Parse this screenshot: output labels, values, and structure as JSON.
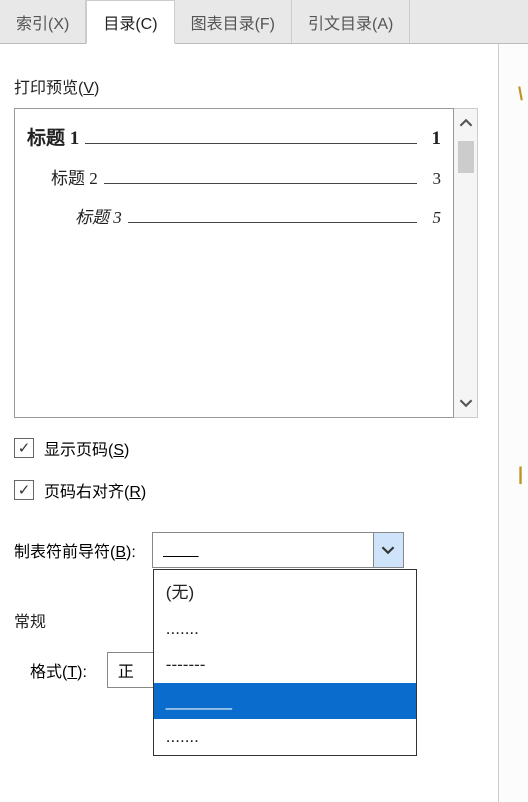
{
  "tabs": {
    "index": "索引(X)",
    "toc": "目录(C)",
    "figures": "图表目录(F)",
    "citations": "引文目录(A)"
  },
  "preview": {
    "label_prefix": "打印预览(",
    "label_key": "V",
    "label_suffix": ")",
    "items": [
      {
        "title": "标题 1",
        "page": "1",
        "level": 1
      },
      {
        "title": "标题 2",
        "page": "3",
        "level": 2
      },
      {
        "title": "标题 3",
        "page": "5",
        "level": 3
      }
    ]
  },
  "options": {
    "show_page_prefix": "显示页码(",
    "show_page_key": "S",
    "show_page_suffix": ")",
    "right_align_prefix": "页码右对齐(",
    "right_align_key": "R",
    "right_align_suffix": ")",
    "tab_leader_prefix": "制表符前导符(",
    "tab_leader_key": "B",
    "tab_leader_suffix": "):",
    "tab_leader_value": "____"
  },
  "dropdown": {
    "options": [
      "(无)",
      ".......",
      "-------",
      "_______",
      "......."
    ],
    "selected_index": 3
  },
  "general": {
    "header": "常规",
    "format_prefix": "格式(",
    "format_key": "T",
    "format_suffix": "):",
    "format_value": "正"
  },
  "checkmark": "✓"
}
